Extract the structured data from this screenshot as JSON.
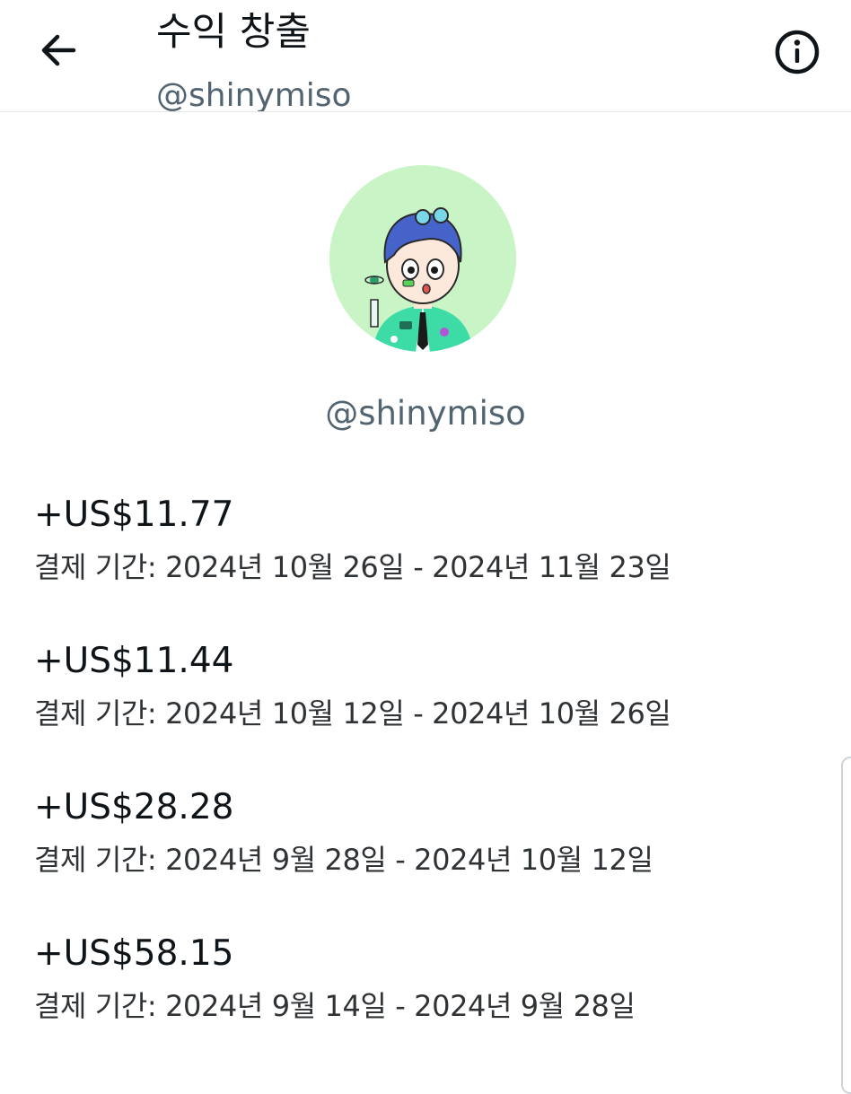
{
  "header": {
    "back_icon": "arrow-left-icon",
    "title": "수익 창출",
    "subtitle": "@shinymiso",
    "info_icon": "info-circle-icon"
  },
  "profile": {
    "avatar_bg": "#c9f5c6",
    "handle": "@shinymiso"
  },
  "payouts": [
    {
      "amount": "+US$11.77",
      "period": "결제 기간: 2024년 10월 26일 - 2024년 11월 23일"
    },
    {
      "amount": "+US$11.44",
      "period": "결제 기간: 2024년 10월 12일 - 2024년 10월 26일"
    },
    {
      "amount": "+US$28.28",
      "period": "결제 기간: 2024년 9월 28일 - 2024년 10월 12일"
    },
    {
      "amount": "+US$58.15",
      "period": "결제 기간: 2024년 9월 14일 - 2024년 9월 28일"
    }
  ]
}
